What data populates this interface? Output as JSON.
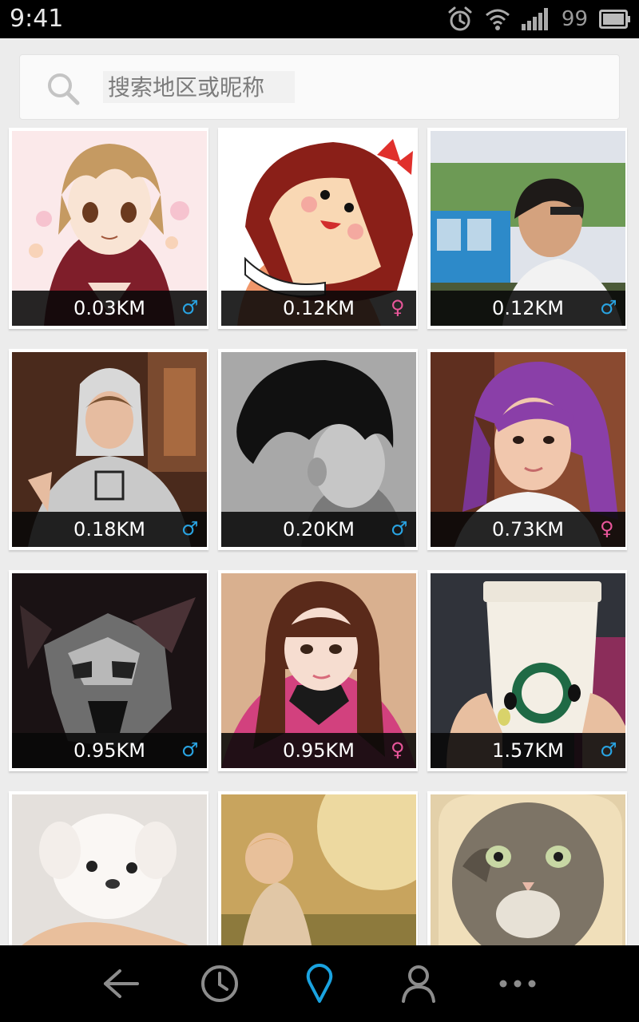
{
  "status_bar": {
    "time": "9:41",
    "battery": "99"
  },
  "search": {
    "placeholder": "搜索地区或昵称",
    "value": ""
  },
  "people": [
    {
      "distance": "0.03KM",
      "gender": "male",
      "gender_symbol": "♂"
    },
    {
      "distance": "0.12KM",
      "gender": "female",
      "gender_symbol": "♀"
    },
    {
      "distance": "0.12KM",
      "gender": "male",
      "gender_symbol": "♂"
    },
    {
      "distance": "0.18KM",
      "gender": "male",
      "gender_symbol": "♂"
    },
    {
      "distance": "0.20KM",
      "gender": "male",
      "gender_symbol": "♂"
    },
    {
      "distance": "0.73KM",
      "gender": "female",
      "gender_symbol": "♀"
    },
    {
      "distance": "0.95KM",
      "gender": "male",
      "gender_symbol": "♂"
    },
    {
      "distance": "0.95KM",
      "gender": "female",
      "gender_symbol": "♀"
    },
    {
      "distance": "1.57KM",
      "gender": "male",
      "gender_symbol": "♂"
    },
    {
      "distance": "",
      "gender": "",
      "gender_symbol": ""
    },
    {
      "distance": "",
      "gender": "",
      "gender_symbol": ""
    },
    {
      "distance": "",
      "gender": "",
      "gender_symbol": ""
    }
  ],
  "nav": {
    "items": [
      {
        "icon": "back-arrow-icon",
        "active": false
      },
      {
        "icon": "clock-icon",
        "active": false
      },
      {
        "icon": "location-pin-icon",
        "active": true
      },
      {
        "icon": "person-icon",
        "active": false
      },
      {
        "icon": "more-dots-icon",
        "active": false
      }
    ]
  },
  "colors": {
    "male": "#29a3e1",
    "female": "#e8569a",
    "active_nav": "#1aa3e0",
    "inactive_nav": "#8c8c8c"
  }
}
